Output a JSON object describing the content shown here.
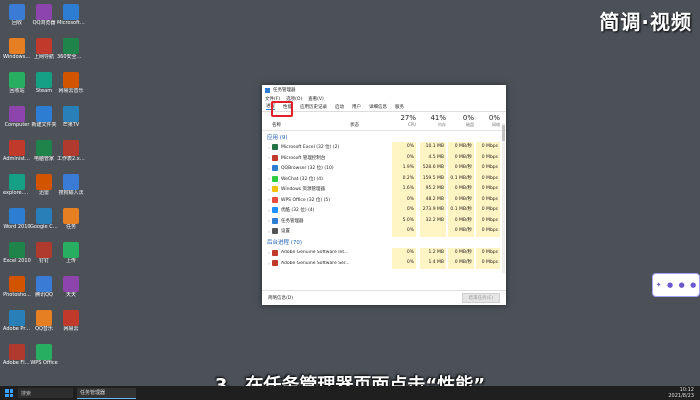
{
  "watermark": "简调·视频",
  "subtitle": "3、在任务管理器页面点击“性能”",
  "desktop": {
    "col1": [
      "回收",
      "Windows\nSettings",
      "回收站",
      "Computer",
      "Administr...",
      "explore.exe",
      "Word 2010",
      "Excel 2010",
      "Photosho...",
      "Adobe Premi...",
      "Adobe Flash Profession..."
    ],
    "col2": [
      "QQ浏览器",
      "上网导航",
      "Steam",
      "新建文件夹",
      "电脑管家",
      "迅雷",
      "Google Chrome",
      "钉钉",
      "腾讯QQ",
      "QQ音乐",
      "WPS Office"
    ],
    "col3": [
      "Microsoft Edge",
      "360安全浏览器",
      "网易云音乐",
      "芒果TV",
      "工作表2.xlsx",
      "搜狗输入法",
      "任务",
      "上传",
      "天天",
      "网易云",
      ""
    ]
  },
  "window": {
    "title": "任务管理器",
    "menu": [
      "文件(F)",
      "选项(O)",
      "查看(V)"
    ],
    "tabs": [
      "进程",
      "性能",
      "应用历史记录",
      "启动",
      "用户",
      "详细信息",
      "服务"
    ],
    "column_headers": {
      "name": "名称",
      "status": "状态",
      "cpu": {
        "pct": "27%",
        "label": "CPU"
      },
      "memory": {
        "pct": "41%",
        "label": "内存"
      },
      "disk": {
        "pct": "0%",
        "label": "磁盘"
      },
      "network": {
        "pct": "0%",
        "label": "网络"
      }
    },
    "apps_section": "应用 (9)",
    "apps": [
      {
        "name": "Microsoft Excel (32 位) (2)",
        "cpu": "0%",
        "mem": "10.1 MB",
        "disk": "0 MB/秒",
        "net": "0 Mbps",
        "color": "#217346"
      },
      {
        "name": "Microsoft 管理控制台",
        "cpu": "0%",
        "mem": "4.5 MB",
        "disk": "0 MB/秒",
        "net": "0 Mbps",
        "color": "#c0392b"
      },
      {
        "name": "QQBrowser (32 位) (10)",
        "cpu": "1.9%",
        "mem": "528.6 MB",
        "disk": "0 MB/秒",
        "net": "0 Mbps",
        "color": "#2d7dd2"
      },
      {
        "name": "WeChat (32 位) (4)",
        "cpu": "0.2%",
        "mem": "159.5 MB",
        "disk": "0.1 MB/秒",
        "net": "0 Mbps",
        "color": "#2ecc40"
      },
      {
        "name": "Windows 资源管理器",
        "cpu": "1.6%",
        "mem": "95.2 MB",
        "disk": "0 MB/秒",
        "net": "0 Mbps",
        "color": "#f4c20d"
      },
      {
        "name": "WPS Office (32 位) (5)",
        "cpu": "0%",
        "mem": "48.2 MB",
        "disk": "0 MB/秒",
        "net": "0 Mbps",
        "color": "#e74c3c"
      },
      {
        "name": "优酷 (32 位) (4)",
        "cpu": "0%",
        "mem": "273.9 MB",
        "disk": "0.1 MB/秒",
        "net": "0 Mbps",
        "color": "#1e90ff"
      },
      {
        "name": "任务管理器",
        "cpu": "5.0%",
        "mem": "32.2 MB",
        "disk": "0 MB/秒",
        "net": "0 Mbps",
        "color": "#2d7dd2"
      },
      {
        "name": "设置",
        "cpu": "0%",
        "mem": "",
        "disk": "0 MB/秒",
        "net": "0 Mbps",
        "color": "#555555"
      }
    ],
    "bg_section": "后台进程 (70)",
    "bg": [
      {
        "name": "Adobe Genuine Software Int...",
        "cpu": "0%",
        "mem": "1.2 MB",
        "disk": "0 MB/秒",
        "net": "0 Mbps",
        "color": "#c0392b"
      },
      {
        "name": "Adobe Genuine Software Ser...",
        "cpu": "0%",
        "mem": "1.4 MB",
        "disk": "0 MB/秒",
        "net": "0 Mbps",
        "color": "#c0392b"
      }
    ],
    "footer_left": "简略信息(D)",
    "footer_button": "结束任务(E)"
  },
  "taskbar": {
    "search": "搜索",
    "app": "任务管理器",
    "time": "10:12",
    "date": "2021/8/23"
  },
  "floatbar": [
    "✦",
    "●",
    "●",
    "●"
  ]
}
